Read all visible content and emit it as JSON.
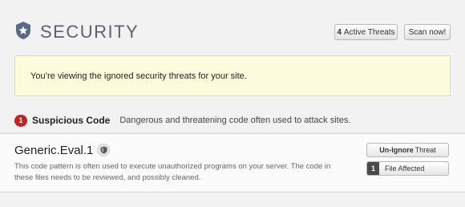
{
  "header": {
    "title": "SECURITY",
    "active_threats_count": "4",
    "active_threats_label": "Active Threats",
    "scan_button_label": "Scan now!"
  },
  "notice": {
    "text": "You’re viewing the ignored security threats for your site."
  },
  "section": {
    "count": "1",
    "title": "Suspicious Code",
    "description": "Dangerous and threatening code often used to attack sites."
  },
  "threat": {
    "name": "Generic.Eval.1",
    "description": "This code pattern is often used to execute unauthorized programs on your server. The code in these files needs to be reviewed, and possibly cleaned.",
    "unignore_bold": "Un-Ignore",
    "unignore_rest": "Threat",
    "files_count": "1",
    "files_label": "File Affected"
  },
  "colors": {
    "background": "#f2f2f2",
    "notice_bg": "#fcfcdc",
    "badge_red": "#c02424",
    "logo_blue": "#5a6a85"
  },
  "icons": {
    "logo": "shield-star-icon",
    "threat_type": "shield-icon"
  }
}
